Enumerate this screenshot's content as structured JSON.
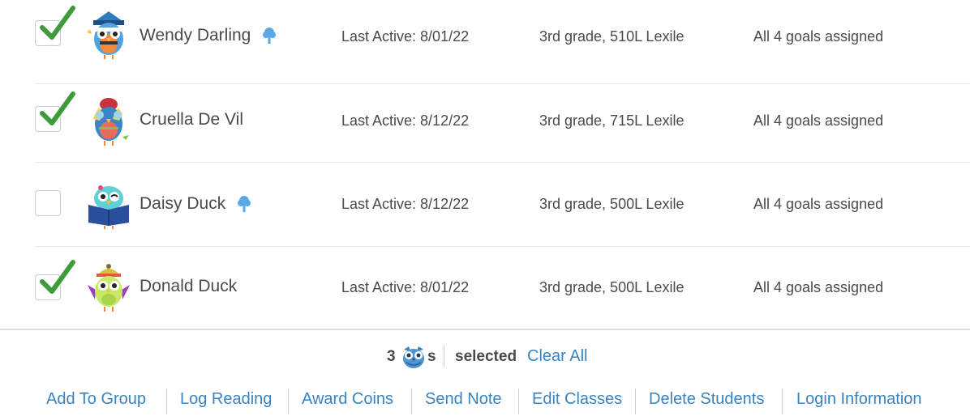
{
  "students": [
    {
      "name": "Wendy Darling",
      "checked": true,
      "tree_icon": true,
      "last_active": "Last Active: 8/01/22",
      "grade_lexile": "3rd grade, 510L Lexile",
      "goals": "All 4 goals assigned",
      "avatar": "owl-wizard-avatar"
    },
    {
      "name": "Cruella De Vil",
      "checked": true,
      "tree_icon": false,
      "last_active": "Last Active: 8/12/22",
      "grade_lexile": "3rd grade, 715L Lexile",
      "goals": "All 4 goals assigned",
      "avatar": "owl-party-avatar"
    },
    {
      "name": "Daisy Duck",
      "checked": false,
      "tree_icon": true,
      "last_active": "Last Active: 8/12/22",
      "grade_lexile": "3rd grade, 500L Lexile",
      "goals": "All 4 goals assigned",
      "avatar": "owl-reader-avatar"
    },
    {
      "name": "Donald Duck",
      "checked": true,
      "tree_icon": false,
      "last_active": "Last Active: 8/01/22",
      "grade_lexile": "3rd grade, 500L Lexile",
      "goals": "All 4 goals assigned",
      "avatar": "owl-beanie-avatar"
    }
  ],
  "selection": {
    "count": "3",
    "suffix": "s",
    "label": "selected",
    "clear_all": "Clear All"
  },
  "actions": [
    "Add To Group",
    "Log Reading",
    "Award Coins",
    "Send Note",
    "Edit Classes",
    "Delete Students",
    "Login Information"
  ],
  "colors": {
    "link": "#3a83c1",
    "check": "#3e9a3a",
    "tree": "#5aa9e6",
    "text": "#4a4a4a"
  }
}
